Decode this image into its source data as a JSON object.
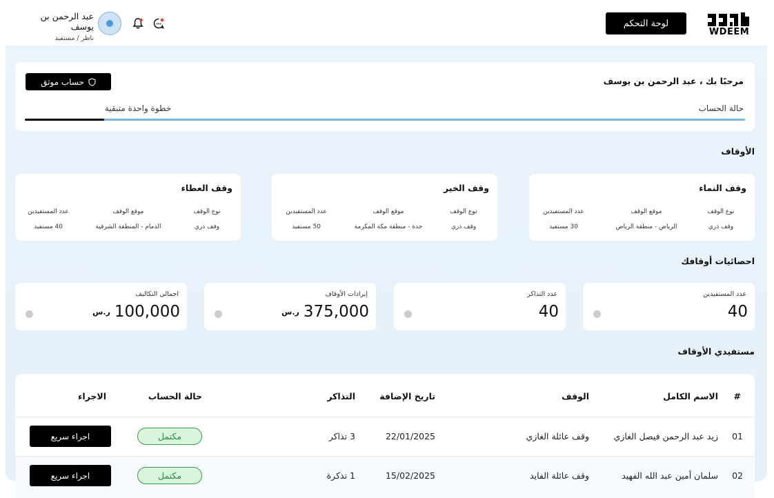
{
  "header": {
    "logo_text": "WDEEM",
    "dashboard_button": "لوحة التحكم",
    "user_name": "عبد الرحمن بن يوسف",
    "user_role": "ناظر / مستفيد"
  },
  "welcome": {
    "greeting": "مرحبًا بك ، عبد الرحمن بن يوسف",
    "verified_button": "حساب موثق",
    "status_label": "حالة الحساب",
    "step_label": "خطوة واحدة متبقية",
    "progress_fraction": 0.89
  },
  "awqaf": {
    "title": "الأوقاف",
    "labels": {
      "type": "نوع الوقف",
      "location": "موقع الوقف",
      "beneficiaries": "عدد المستفيدين"
    },
    "items": [
      {
        "name": "وقف النماء",
        "type": "وقف ذري",
        "location": "الرياض - منطقة الرياض",
        "beneficiaries": "30 مستفيد"
      },
      {
        "name": "وقف الخير",
        "type": "وقف ذري",
        "location": "جدة - منطقة مكة المكرمة",
        "beneficiaries": "50 مستفيد"
      },
      {
        "name": "وقف العطاء",
        "type": "وقف ذري",
        "location": "الدمام - المنطقة الشرقية",
        "beneficiaries": "40 مستفيد"
      }
    ]
  },
  "stats": {
    "title": "احصائيات أوقافك",
    "currency": "ر.س",
    "items": [
      {
        "label": "عدد المستفيدين",
        "value": "40",
        "currency": false
      },
      {
        "label": "عدد التذاكر",
        "value": "40",
        "currency": false
      },
      {
        "label": "إيرادات الأوقاف",
        "value": "375,000",
        "currency": true
      },
      {
        "label": "اجمالي التكاليف",
        "value": "100,000",
        "currency": true
      }
    ]
  },
  "beneficiaries": {
    "title": "مستفيدي الأوقاف",
    "columns": {
      "num": "#",
      "name": "الاسم الكامل",
      "waqf": "الوقف",
      "date": "تاريخ الإضافة",
      "tickets": "التذاكر",
      "status": "حالة الحساب",
      "action": "الاجراء"
    },
    "rows": [
      {
        "num": "01",
        "name": "زيد عبد الرحمن فيصل الغازي",
        "waqf": "وقف عائلة الغازي",
        "date": "22/01/2025",
        "tickets": "3 تذاكر",
        "status": "مكتمل",
        "action": "اجراء سريع"
      },
      {
        "num": "02",
        "name": "سلمان أمين عبد الله الفهيد",
        "waqf": "وقف عائلة الفايد",
        "date": "15/02/2025",
        "tickets": "1 تذكرة",
        "status": "مكتمل",
        "action": "اجراء سريع"
      }
    ]
  },
  "colors": {
    "accent": "#7ab6e0",
    "background": "#e8f2fb",
    "badge_green": "#3c9a4e"
  }
}
